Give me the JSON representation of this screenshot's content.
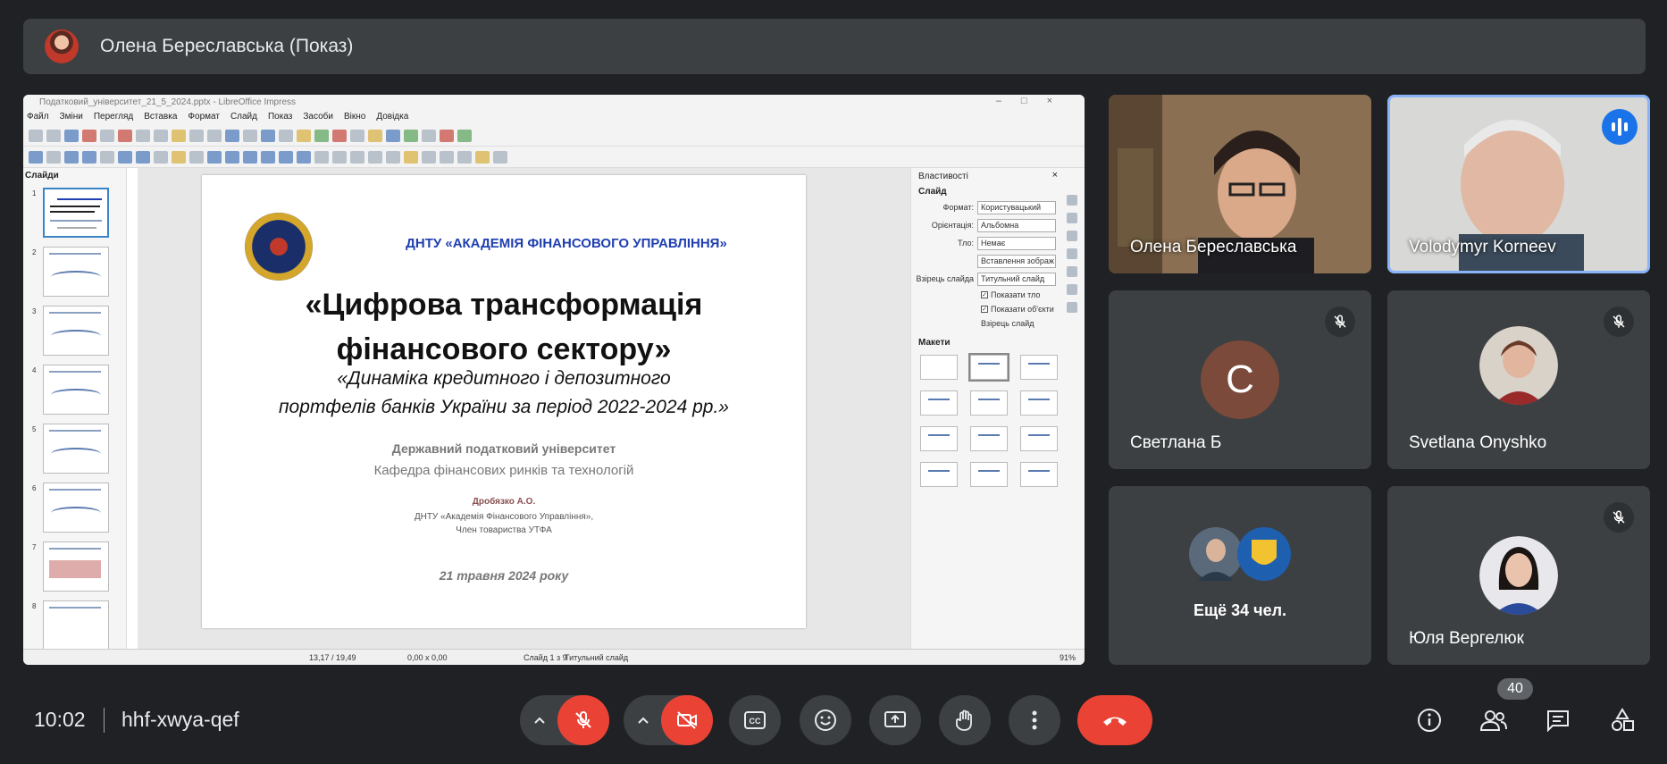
{
  "presenter": {
    "name": "Олена Береславська (Показ)"
  },
  "impress": {
    "window_title": "Податковий_університет_21_5_2024.pptx - LibreOffice Impress",
    "menu": [
      "Файл",
      "Зміни",
      "Перегляд",
      "Вставка",
      "Формат",
      "Слайд",
      "Показ",
      "Засоби",
      "Вікно",
      "Довідка"
    ],
    "slides_panel_title": "Слайди",
    "thumb_numbers": [
      "1",
      "2",
      "3",
      "4",
      "5",
      "6",
      "7",
      "8"
    ],
    "slide": {
      "org": "ДНТУ «АКАДЕМІЯ ФІНАНСОВОГО УПРАВЛІННЯ»",
      "title_line1": "«Цифрова трансформація",
      "title_line2": "фінансового сектору»",
      "sub_line1": "«Динаміка кредитного і депозитного",
      "sub_line2": "портфелів банків України за період 2022-2024 рр.»",
      "university": "Державний податковий університет",
      "department": "Кафедра фінансових ринків та технологій",
      "author": "Дробязко А.О.",
      "affiliation1": "ДНТУ «Академія Фінансового Управління»,",
      "affiliation2": "Член товариства УТФА",
      "date": "21 травня 2024 року"
    },
    "properties": {
      "title": "Властивості",
      "section_slide": "Слайд",
      "format_label": "Формат:",
      "format_value": "Користувацький",
      "orientation_label": "Орієнтація:",
      "orientation_value": "Альбомна",
      "background_label": "Тло:",
      "background_value": "Немає",
      "insert_image": "Вставлення зображ",
      "master_label": "Взірець слайда",
      "master_value": "Титульний слайд",
      "show_background": "Показати тло",
      "show_objects": "Показати об'єкти",
      "master_button": "Взірець слайд",
      "section_layouts": "Макети"
    },
    "status": {
      "position": "13,17 / 19,49",
      "size": "0,00 x 0,00",
      "slide_of": "Слайд 1 з 9",
      "master": "Титульний слайд",
      "zoom": "91%"
    }
  },
  "participants": [
    {
      "name": "Олена Береславська",
      "muted": false
    },
    {
      "name": "Volodymyr Korneev",
      "speaking": true
    },
    {
      "name": "Светлана Б",
      "initial": "С",
      "muted": true
    },
    {
      "name": "Svetlana Onyshko",
      "muted": true
    },
    {
      "name": "Ещё 34 чел."
    },
    {
      "name": "Юля Вергелюк",
      "muted": true
    }
  ],
  "meeting": {
    "time": "10:02",
    "code": "hhf-xwya-qef",
    "participant_count": "40"
  },
  "colors": {
    "end_call": "#ea4335",
    "accent": "#8ab4f8",
    "speaking": "#1a73e8"
  }
}
